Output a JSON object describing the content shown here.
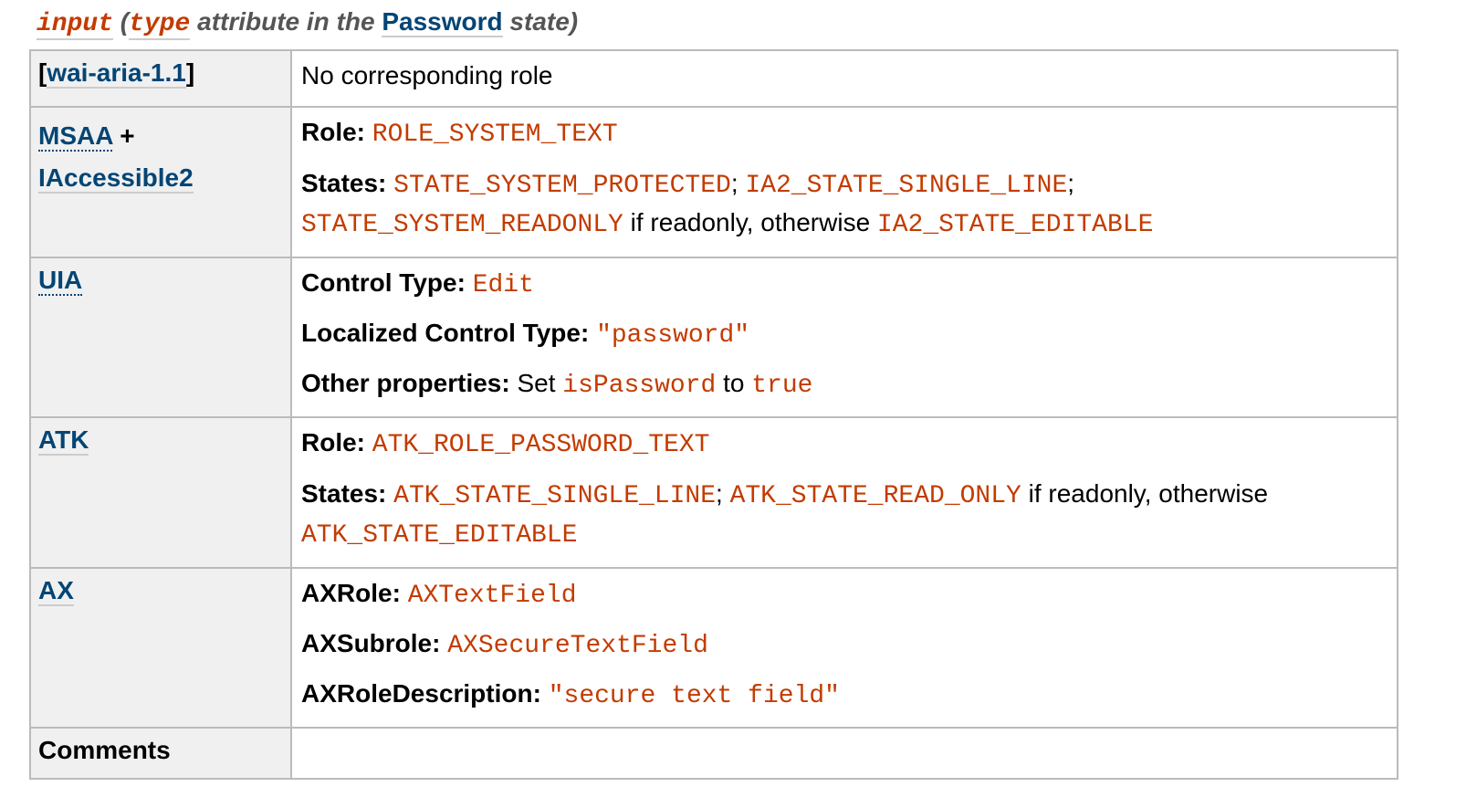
{
  "caption": {
    "element": "input",
    "open_paren": "(",
    "attr": "type",
    "text1": "attribute in the",
    "state": "Password",
    "text2": "state)"
  },
  "rows": {
    "aria": {
      "header_open": "[",
      "header_link": "wai-aria-1.1",
      "header_close": "]",
      "value": "No corresponding role"
    },
    "msaa": {
      "header_link1": "MSAA",
      "header_plus": "+",
      "header_link2": "IAccessible2",
      "role_label": "Role:",
      "role_value": "ROLE_SYSTEM_TEXT",
      "states_label": "States:",
      "state1": "STATE_SYSTEM_PROTECTED",
      "sep1": ";",
      "state2": "IA2_STATE_SINGLE_LINE",
      "sep2": ";",
      "state3": "STATE_SYSTEM_READONLY",
      "text_if": "if readonly, otherwise",
      "state4": "IA2_STATE_EDITABLE"
    },
    "uia": {
      "header_link": "UIA",
      "ct_label": "Control Type:",
      "ct_value": "Edit",
      "lct_label": "Localized Control Type:",
      "lct_value": "\"password\"",
      "op_label": "Other properties:",
      "op_text1": "Set",
      "op_code1": "isPassword",
      "op_text2": "to",
      "op_code2": "true"
    },
    "atk": {
      "header_link": "ATK",
      "role_label": "Role:",
      "role_value": "ATK_ROLE_PASSWORD_TEXT",
      "states_label": "States:",
      "state1": "ATK_STATE_SINGLE_LINE",
      "sep1": ";",
      "state2": "ATK_STATE_READ_ONLY",
      "text_if": "if readonly, otherwise",
      "state3": "ATK_STATE_EDITABLE"
    },
    "ax": {
      "header_link": "AX",
      "role_label": "AXRole:",
      "role_value": "AXTextField",
      "subrole_label": "AXSubrole:",
      "subrole_value": "AXSecureTextField",
      "desc_label": "AXRoleDescription:",
      "desc_value": "\"secure text field\""
    },
    "comments": {
      "header": "Comments",
      "value": ""
    }
  },
  "colors": {
    "code": "#c33b00",
    "link": "#034575",
    "header_bg": "#f0f0f0",
    "border": "#bbbbbb"
  }
}
